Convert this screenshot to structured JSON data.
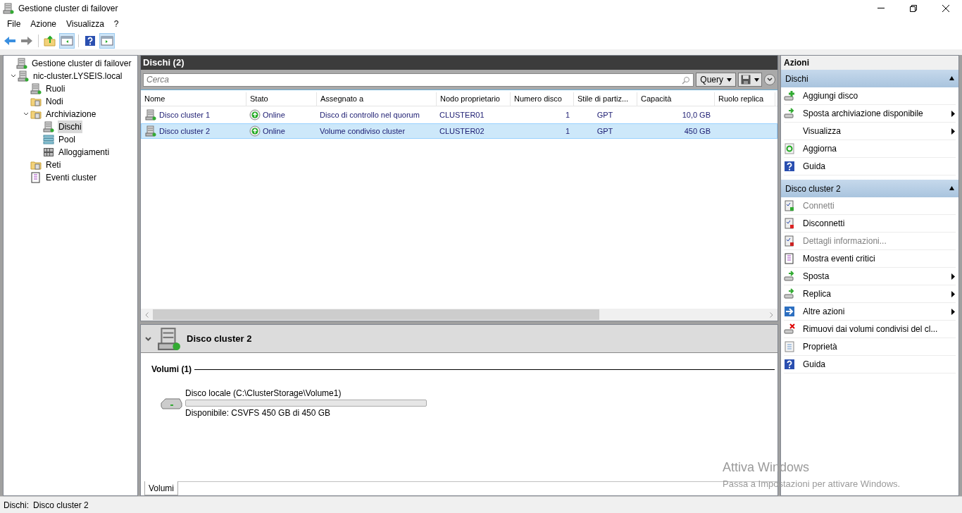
{
  "window": {
    "title": "Gestione cluster di failover"
  },
  "menu": [
    "File",
    "Azione",
    "Visualizza",
    "?"
  ],
  "toolbar": [
    {
      "pressed": false
    },
    {
      "pressed": false
    },
    {
      "pressed": false
    },
    {
      "pressed": true
    },
    {
      "pressed": false
    },
    {
      "pressed": true
    }
  ],
  "tree": [
    {
      "label": "Gestione cluster di failover",
      "selected": false,
      "children": [
        {
          "label": "nic-cluster.LYSEIS.local",
          "selected": false,
          "expanded": true,
          "children": [
            {
              "label": "Ruoli",
              "selected": false
            },
            {
              "label": "Nodi",
              "selected": false
            },
            {
              "label": "Archiviazione",
              "selected": false,
              "expanded": true,
              "children": [
                {
                  "label": "Dischi",
                  "selected": true
                },
                {
                  "label": "Pool",
                  "selected": false
                },
                {
                  "label": "Alloggiamenti",
                  "selected": false
                }
              ]
            },
            {
              "label": "Reti",
              "selected": false
            },
            {
              "label": "Eventi cluster",
              "selected": false
            }
          ]
        }
      ]
    }
  ],
  "center": {
    "title": "Dischi (2)",
    "search": {
      "placeholder": "Cerca"
    },
    "query_button": "Query",
    "table": {
      "columns": [
        "Nome",
        "Stato",
        "Assegnato a",
        "Nodo proprietario",
        "Numero disco",
        "Stile di partiz...",
        "Capacità",
        "Ruolo replica"
      ],
      "rows": [
        {
          "selected": false,
          "cells": [
            "Disco cluster 1",
            "Online",
            "Disco di controllo nel quorum",
            "CLUSTER01",
            "1",
            "GPT",
            "10,0 GB",
            ""
          ]
        },
        {
          "selected": true,
          "cells": [
            "Disco cluster 2",
            "Online",
            "Volume condiviso cluster",
            "CLUSTER02",
            "1",
            "GPT",
            "450 GB",
            ""
          ]
        }
      ]
    }
  },
  "detail": {
    "title": "Disco cluster 2",
    "section": "Volumi (1)",
    "volume": {
      "name": "Disco locale (C:\\ClusterStorage\\Volume1)",
      "level": 0,
      "free": "Disponibile: CSVFS 450 GB di 450 GB"
    },
    "tabs": [
      {
        "label": "Volumi",
        "selected": true
      }
    ]
  },
  "actions": {
    "title": "Azioni",
    "sections": [
      {
        "title": "Dischi",
        "expanded": true,
        "items": [
          {
            "label": "Aggiungi disco",
            "disabled": false,
            "submenu": false
          },
          {
            "label": "Sposta archiviazione disponibile",
            "disabled": false,
            "submenu": true
          },
          {
            "label": "Visualizza",
            "disabled": false,
            "submenu": true
          },
          {
            "label": "Aggiorna",
            "disabled": false,
            "submenu": false
          },
          {
            "label": "Guida",
            "disabled": false,
            "submenu": false
          }
        ]
      },
      {
        "title": "Disco cluster 2",
        "expanded": true,
        "items": [
          {
            "label": "Connetti",
            "disabled": true,
            "submenu": false
          },
          {
            "label": "Disconnetti",
            "disabled": false,
            "submenu": false
          },
          {
            "label": "Dettagli informazioni...",
            "disabled": true,
            "submenu": false
          },
          {
            "label": "Mostra eventi critici",
            "disabled": false,
            "submenu": false
          },
          {
            "label": "Sposta",
            "disabled": false,
            "submenu": true
          },
          {
            "label": "Replica",
            "disabled": false,
            "submenu": true
          },
          {
            "label": "Altre azioni",
            "disabled": false,
            "submenu": true
          },
          {
            "label": "Rimuovi dai volumi condivisi del cl...",
            "disabled": false,
            "submenu": false
          },
          {
            "label": "Proprietà",
            "disabled": false,
            "submenu": false
          },
          {
            "label": "Guida",
            "disabled": false,
            "submenu": false
          }
        ]
      }
    ]
  },
  "status_bar": [
    "Dischi:",
    "Disco cluster 2"
  ],
  "activation_notice": {
    "title": "Attiva Windows",
    "text": "Passa a Impostazioni per attivare Windows."
  }
}
